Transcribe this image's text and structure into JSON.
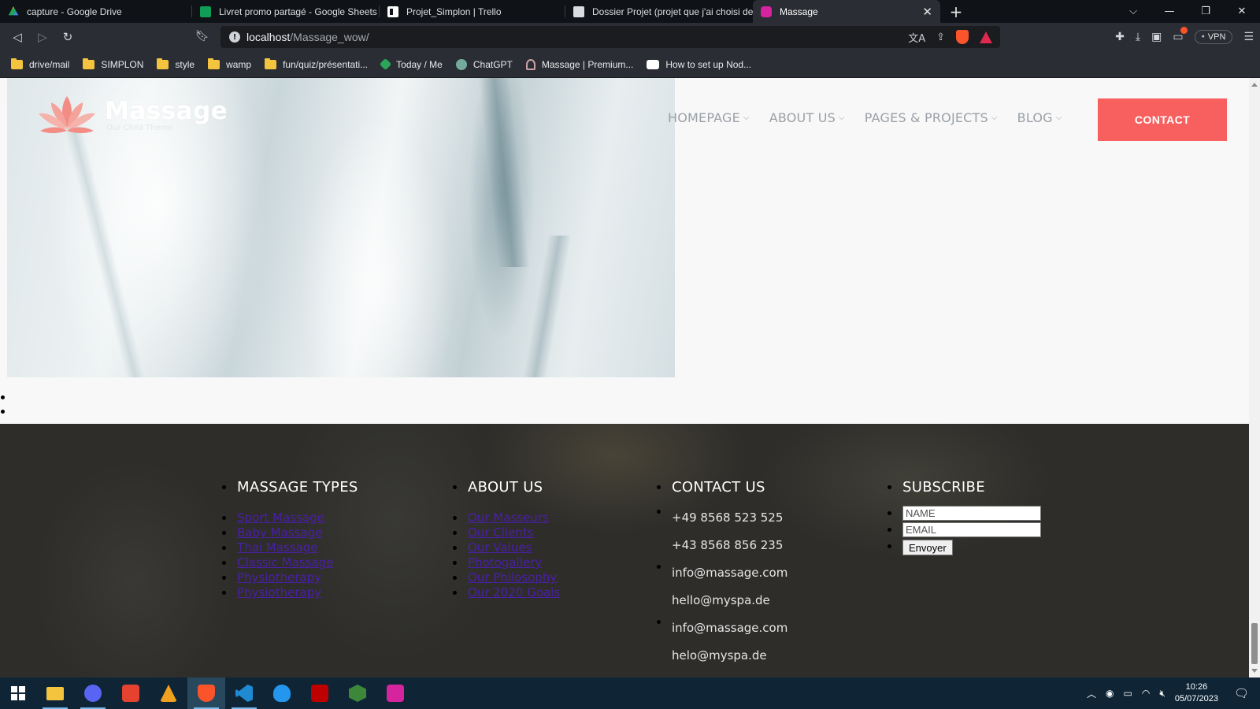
{
  "browser": {
    "tabs": [
      {
        "title": "capture - Google Drive",
        "color": "#1fa463",
        "active": false
      },
      {
        "title": "Livret promo partagé - Google Sheets",
        "color": "#0f9d58",
        "active": false
      },
      {
        "title": "Projet_Simplon | Trello",
        "color": "#ffffff",
        "active": false
      },
      {
        "title": "Dossier Projet (projet que j'ai choisi de",
        "color": "#dadce0",
        "active": false
      },
      {
        "title": "Massage",
        "color": "#d6249f",
        "active": true
      }
    ],
    "url_host": "localhost",
    "url_path": "/Massage_wow/",
    "vpn_label": "VPN",
    "bookmarks": [
      {
        "label": "drive/mail",
        "icon": "folder-icon"
      },
      {
        "label": "SIMPLON",
        "icon": "folder-icon"
      },
      {
        "label": "style",
        "icon": "folder-icon"
      },
      {
        "label": "wamp",
        "icon": "folder-icon"
      },
      {
        "label": "fun/quiz/présentati...",
        "icon": "folder-icon"
      },
      {
        "label": "Today / Me",
        "icon": "ticktick-icon"
      },
      {
        "label": "ChatGPT",
        "icon": "chatgpt-icon"
      },
      {
        "label": "Massage | Premium...",
        "icon": "massage-site-icon"
      },
      {
        "label": "How to set up Nod...",
        "icon": "medium-icon"
      }
    ]
  },
  "site": {
    "logo_title": "Massage",
    "logo_subtitle": "Our Child Theme",
    "nav": [
      "HOMEPAGE",
      "ABOUT US",
      "PAGES & PROJECTS",
      "BLOG"
    ],
    "contact_button": "CONTACT",
    "accent_color": "#f85f5f"
  },
  "footer": {
    "massage_types": {
      "heading": "MASSAGE TYPES",
      "links": [
        "Sport Massage",
        "Baby Massage",
        "Thai Massage",
        "Classic Massage",
        "Physiotherapy",
        "Physiotherapy"
      ]
    },
    "about_us": {
      "heading": "ABOUT US",
      "links": [
        "Our Masseurs",
        "Our Clients",
        "Our Values",
        "Photogallery",
        "Our Philosophy",
        "Our 2020 Goals"
      ]
    },
    "contact_us": {
      "heading": "CONTACT US",
      "lines": [
        "+49 8568 523 525",
        "+43 8568 856 235",
        "info@massage.com",
        "hello@myspa.de",
        "info@massage.com",
        "helo@myspa.de"
      ]
    },
    "subscribe": {
      "heading": "SUBSCRIBE",
      "name_placeholder": "NAME",
      "email_placeholder": "EMAIL",
      "submit_label": "Envoyer"
    }
  },
  "taskbar": {
    "apps": [
      "file-explorer-icon",
      "discord-icon",
      "xmind-icon",
      "sourcetree-icon",
      "brave-icon",
      "vscode-icon",
      "docker-icon",
      "filezilla-icon",
      "nodejs-icon",
      "wampserver-icon"
    ],
    "time": "10:26",
    "date": "05/07/2023"
  }
}
